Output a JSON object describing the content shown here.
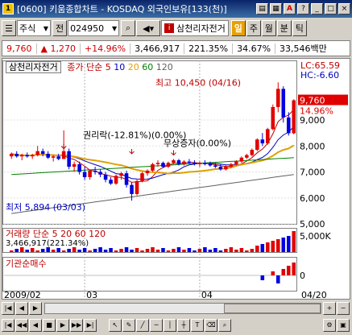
{
  "window": {
    "title": "[0600] 키움종합차트 - KOSDAQ 외국인보유[133(천)]",
    "icon_text": "1"
  },
  "toolbar": {
    "market": "주식",
    "prev_label": "전",
    "code": "024950",
    "stock_name": "삼천리자전거",
    "period_buttons": [
      "일",
      "주",
      "월",
      "분",
      "틱"
    ],
    "active_period": "일"
  },
  "quote": {
    "price": "9,760",
    "change": "1,270",
    "change_pct": "+14.96%",
    "volume": "3,466,917",
    "volume_ratio": "221.35%",
    "turnover": "34.67%",
    "trade_value": "33,546백만"
  },
  "chart": {
    "stock_label": "삼천리자전거",
    "ma_legend": {
      "prefix": "종가 단순",
      "periods": [
        "5",
        "10",
        "20",
        "60",
        "120"
      ]
    },
    "lc_label": "LC:65.59",
    "hc_label": "HC:-6.60",
    "high_annotation": "최고 10,450 (04/16)",
    "low_annotation": "최저 5,894 (03/03)",
    "event1": "권리락(-12.81%)(0.00%)",
    "event2": "무상증자(0.00%)",
    "event3": "무상증자(0.00%)",
    "last_price_tag": "9,760",
    "last_pct_tag": "14.96%",
    "price_axis": [
      "9,000",
      "8,000",
      "7,000",
      "6,000",
      "5,000"
    ],
    "volume_legend": {
      "prefix": "거래량 단순",
      "periods": [
        "5",
        "20",
        "60",
        "120"
      ]
    },
    "volume_value": "3,466,917(221.34%)",
    "volume_axis": "5,000K",
    "inst_label": "기관순매수",
    "inst_axis": "0",
    "date_labels": [
      "2009/02",
      "03",
      "04",
      "04/20"
    ]
  },
  "chart_data": {
    "type": "candlestick",
    "candles": [
      [
        7600,
        7750,
        7500,
        7700
      ],
      [
        7700,
        7800,
        7550,
        7600
      ],
      [
        7600,
        7700,
        7450,
        7650
      ],
      [
        7650,
        7750,
        7550,
        7600
      ],
      [
        7600,
        7700,
        7500,
        7650
      ],
      [
        7650,
        8000,
        7600,
        7800
      ],
      [
        7800,
        7900,
        7600,
        7700
      ],
      [
        7700,
        7800,
        7500,
        7550
      ],
      [
        7550,
        7650,
        7400,
        7600
      ],
      [
        7600,
        7700,
        7450,
        7500
      ],
      [
        7500,
        8600,
        7500,
        7800
      ],
      [
        7800,
        7900,
        7100,
        7200
      ],
      [
        7200,
        7400,
        7000,
        7300
      ],
      [
        7300,
        7400,
        6900,
        7000
      ],
      [
        7000,
        7200,
        6700,
        6800
      ],
      [
        6800,
        7100,
        6700,
        7050
      ],
      [
        7050,
        7200,
        6900,
        7000
      ],
      [
        7000,
        7100,
        6800,
        6900
      ],
      [
        6900,
        7000,
        6600,
        6700
      ],
      [
        6700,
        6800,
        6500,
        6550
      ],
      [
        6550,
        6900,
        6500,
        6850
      ],
      [
        6850,
        7000,
        6700,
        6950
      ],
      [
        6950,
        7050,
        6400,
        6500
      ],
      [
        6500,
        6600,
        5894,
        6150
      ],
      [
        6150,
        6700,
        6100,
        6650
      ],
      [
        6650,
        7000,
        6600,
        6950
      ],
      [
        6950,
        7100,
        6850,
        7050
      ],
      [
        7050,
        7350,
        7000,
        7300
      ],
      [
        7300,
        7450,
        7200,
        7350
      ],
      [
        7350,
        7400,
        7150,
        7200
      ],
      [
        7200,
        7400,
        7150,
        7350
      ],
      [
        7350,
        7500,
        7300,
        7450
      ],
      [
        7450,
        7500,
        7250,
        7300
      ],
      [
        7300,
        7450,
        7250,
        7400
      ],
      [
        7400,
        7500,
        7300,
        7350
      ],
      [
        7350,
        7450,
        7250,
        7300
      ],
      [
        7300,
        7400,
        7200,
        7350
      ],
      [
        7350,
        7450,
        7250,
        7300
      ],
      [
        7300,
        7400,
        7200,
        7250
      ],
      [
        7250,
        7350,
        7150,
        7200
      ],
      [
        7200,
        7300,
        7050,
        7100
      ],
      [
        7100,
        7250,
        7050,
        7200
      ],
      [
        7200,
        7350,
        7150,
        7300
      ],
      [
        7300,
        7450,
        7250,
        7400
      ],
      [
        7400,
        7600,
        7350,
        7550
      ],
      [
        7550,
        7700,
        7500,
        7650
      ],
      [
        7650,
        7900,
        7600,
        7850
      ],
      [
        7850,
        8300,
        7800,
        8250
      ],
      [
        8250,
        8500,
        8000,
        8100
      ],
      [
        8100,
        8700,
        8050,
        8650
      ],
      [
        8650,
        9600,
        8600,
        9500
      ],
      [
        9500,
        10450,
        9300,
        10200
      ],
      [
        10200,
        10300,
        8900,
        9100
      ],
      [
        9100,
        9300,
        8400,
        8490
      ],
      [
        8490,
        9800,
        8450,
        9760
      ]
    ],
    "ylim": [
      5000,
      10800
    ],
    "x_labels": [
      "2009/02",
      "03",
      "04",
      "04/20"
    ]
  }
}
